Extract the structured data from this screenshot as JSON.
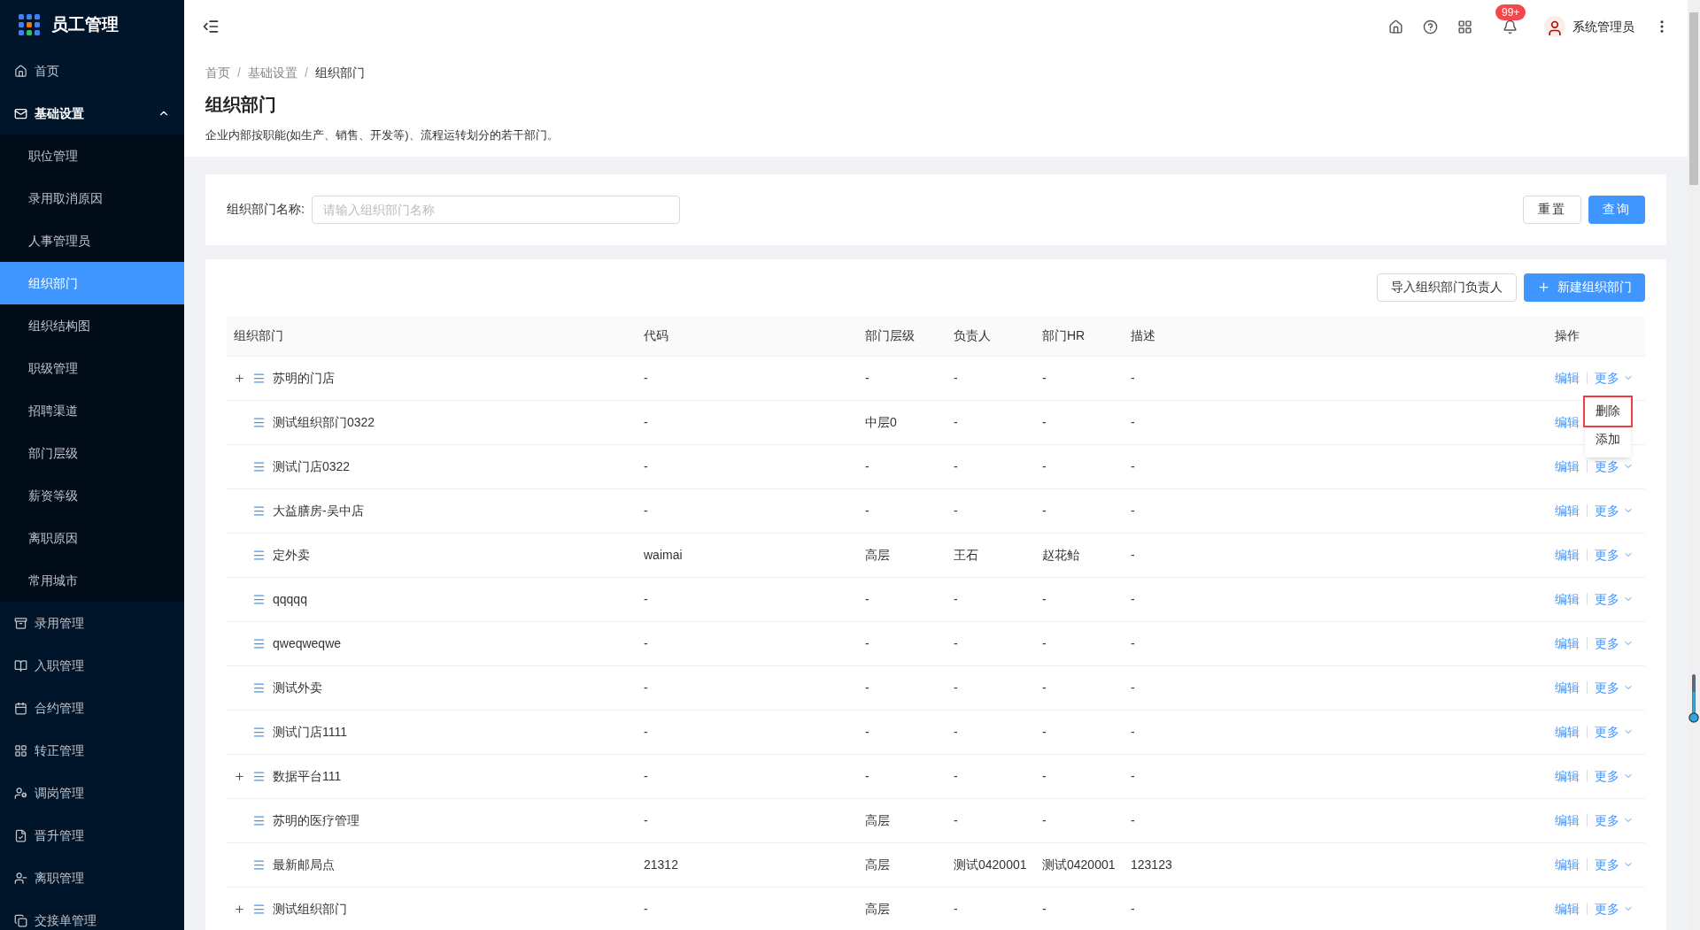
{
  "app": {
    "title": "员工管理"
  },
  "sidebar": {
    "items": [
      {
        "label": "首页",
        "selected": false
      },
      {
        "label": "基础设置",
        "selected": false,
        "expanded": true,
        "children": [
          {
            "label": "职位管理",
            "selected": false
          },
          {
            "label": "录用取消原因",
            "selected": false
          },
          {
            "label": "人事管理员",
            "selected": false
          },
          {
            "label": "组织部门",
            "selected": true
          },
          {
            "label": "组织结构图",
            "selected": false
          },
          {
            "label": "职级管理",
            "selected": false
          },
          {
            "label": "招聘渠道",
            "selected": false
          },
          {
            "label": "部门层级",
            "selected": false
          },
          {
            "label": "薪资等级",
            "selected": false
          },
          {
            "label": "离职原因",
            "selected": false
          },
          {
            "label": "常用城市",
            "selected": false
          }
        ]
      },
      {
        "label": "录用管理",
        "selected": false
      },
      {
        "label": "入职管理",
        "selected": false
      },
      {
        "label": "合约管理",
        "selected": false
      },
      {
        "label": "转正管理",
        "selected": false
      },
      {
        "label": "调岗管理",
        "selected": false
      },
      {
        "label": "晋升管理",
        "selected": false
      },
      {
        "label": "离职管理",
        "selected": false
      },
      {
        "label": "交接单管理",
        "selected": false
      }
    ]
  },
  "header": {
    "notification_badge": "99+",
    "user_name": "系统管理员"
  },
  "breadcrumb": [
    {
      "label": "首页"
    },
    {
      "separator": "/",
      "label": "基础设置"
    },
    {
      "separator": "/",
      "label": "组织部门"
    }
  ],
  "page": {
    "title": "组织部门",
    "description": "企业内部按职能(如生产、销售、开发等)、流程运转划分的若干部门。"
  },
  "search": {
    "label": "组织部门名称:",
    "placeholder": "请输入组织部门名称",
    "buttons": [
      "重置",
      "查询"
    ]
  },
  "toolbar": {
    "buttons": [
      "导入组织部门负责人",
      "新建组织部门"
    ]
  },
  "table": {
    "columns": [
      "组织部门",
      "代码",
      "部门层级",
      "负责人",
      "部门HR",
      "描述",
      "操作"
    ],
    "rows": [
      {
        "kind": "parent",
        "cells": [
          "苏明的门店",
          "-",
          "-",
          "-",
          "-",
          "-"
        ],
        "actions": [
          "编辑",
          "更多"
        ],
        "menu": [
          {
            "label": "删除",
            "highlighted": true
          },
          {
            "label": "添加",
            "highlighted": false
          }
        ]
      },
      {
        "kind": "leaf",
        "cells": [
          "测试组织部门0322",
          "-",
          "中层0",
          "-",
          "-",
          "-"
        ],
        "actions": [
          "编辑"
        ]
      },
      {
        "kind": "leaf",
        "cells": [
          "测试门店0322",
          "-",
          "-",
          "-",
          "-",
          "-"
        ],
        "actions": [
          "编辑",
          "更多"
        ]
      },
      {
        "kind": "leaf",
        "cells": [
          "大益膳房-吴中店",
          "-",
          "-",
          "-",
          "-",
          "-"
        ],
        "actions": [
          "编辑",
          "更多"
        ]
      },
      {
        "kind": "leaf",
        "cells": [
          "定外卖",
          "waimai",
          "高层",
          "王石",
          "赵花鲐",
          "-"
        ],
        "actions": [
          "编辑",
          "更多"
        ]
      },
      {
        "kind": "leaf",
        "cells": [
          "qqqqq",
          "-",
          "-",
          "-",
          "-",
          "-"
        ],
        "actions": [
          "编辑",
          "更多"
        ]
      },
      {
        "kind": "leaf",
        "cells": [
          "qweqweqwe",
          "-",
          "-",
          "-",
          "-",
          "-"
        ],
        "actions": [
          "编辑",
          "更多"
        ]
      },
      {
        "kind": "leaf",
        "cells": [
          "测试外卖",
          "-",
          "-",
          "-",
          "-",
          "-"
        ],
        "actions": [
          "编辑",
          "更多"
        ]
      },
      {
        "kind": "leaf",
        "cells": [
          "测试门店1111",
          "-",
          "-",
          "-",
          "-",
          "-"
        ],
        "actions": [
          "编辑",
          "更多"
        ]
      },
      {
        "kind": "parent",
        "cells": [
          "数据平台111",
          "-",
          "-",
          "-",
          "-",
          "-"
        ],
        "actions": [
          "编辑",
          "更多"
        ]
      },
      {
        "kind": "leaf",
        "cells": [
          "苏明的医疗管理",
          "-",
          "高层",
          "-",
          "-",
          "-"
        ],
        "actions": [
          "编辑",
          "更多"
        ]
      },
      {
        "kind": "leaf",
        "cells": [
          "最新邮局点",
          "21312",
          "高层",
          "测试0420001",
          "测试0420001",
          "123123"
        ],
        "actions": [
          "编辑",
          "更多"
        ]
      },
      {
        "kind": "parent",
        "cells": [
          "测试组织部门",
          "-",
          "高层",
          "-",
          "-",
          "-"
        ],
        "actions": [
          "编辑",
          "更多"
        ]
      }
    ]
  }
}
